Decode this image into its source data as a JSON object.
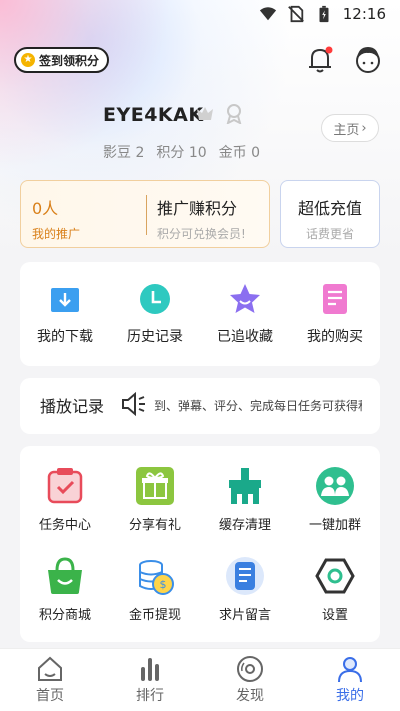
{
  "status_bar": {
    "time": "12:16"
  },
  "header": {
    "checkin_label": "签到领积分"
  },
  "profile": {
    "username": "EYE4KAK",
    "home_label": "主页",
    "stats": [
      {
        "label": "影豆",
        "value": "2"
      },
      {
        "label": "积分",
        "value": "10"
      },
      {
        "label": "金币",
        "value": "0"
      }
    ]
  },
  "promo": {
    "count": "0人",
    "count_label": "我的推广",
    "title": "推广赚积分",
    "subtitle": "积分可兑换会员!"
  },
  "recharge": {
    "title": "超低充值",
    "subtitle": "话费更省"
  },
  "quick_actions": [
    {
      "label": "我的下载",
      "icon": "download-icon",
      "color": "#3b9ff0"
    },
    {
      "label": "历史记录",
      "icon": "clock-icon",
      "color": "#2ec9c0"
    },
    {
      "label": "已追收藏",
      "icon": "star-icon",
      "color": "#8b6ff0"
    },
    {
      "label": "我的购买",
      "icon": "purchase-icon",
      "color": "#f07ad0"
    }
  ],
  "play_record": {
    "title": "播放记录",
    "marquee": "到、弹幕、评分、完成每日任务可获得积分"
  },
  "grid_items": [
    {
      "label": "任务中心",
      "icon": "task-icon",
      "color": "#e84b5a"
    },
    {
      "label": "分享有礼",
      "icon": "gift-icon",
      "color": "#8cc63f"
    },
    {
      "label": "缓存清理",
      "icon": "broom-icon",
      "color": "#1aa98a"
    },
    {
      "label": "一键加群",
      "icon": "group-icon",
      "color": "#2fbf8f"
    },
    {
      "label": "积分商城",
      "icon": "shop-icon",
      "color": "#3bb34a"
    },
    {
      "label": "金币提现",
      "icon": "coins-icon",
      "color": "#3a8ee8"
    },
    {
      "label": "求片留言",
      "icon": "message-icon",
      "color": "#3a7fe0"
    },
    {
      "label": "设置",
      "icon": "settings-icon",
      "color": "#333333"
    }
  ],
  "tabs": [
    {
      "label": "首页",
      "icon": "home-icon"
    },
    {
      "label": "排行",
      "icon": "ranking-icon"
    },
    {
      "label": "发现",
      "icon": "discover-icon"
    },
    {
      "label": "我的",
      "icon": "profile-icon"
    }
  ],
  "colors": {
    "accent": "#3a6ee8",
    "promo_orange": "#d9801a"
  }
}
